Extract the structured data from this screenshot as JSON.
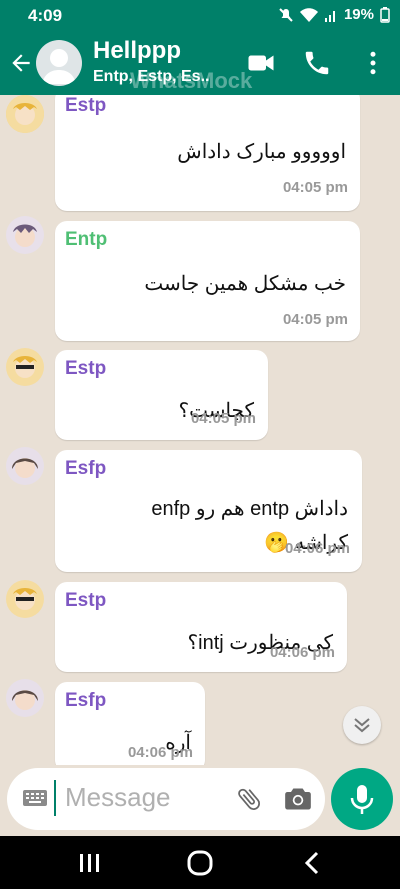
{
  "status_bar": {
    "time": "4:09",
    "battery": "19%"
  },
  "app_bar": {
    "title": "Hellppp",
    "subtitle": "Entp, Estp, Es..",
    "watermark": "WhatsMock"
  },
  "messages": [
    {
      "sender": "Estp",
      "sender_color": "#7e57c2",
      "text": "اووووو مبارک داداش",
      "time": "04:05 pm"
    },
    {
      "sender": "Entp",
      "sender_color": "#4fbf74",
      "text": "خب مشکل همین جاست",
      "time": "04:05 pm"
    },
    {
      "sender": "Estp",
      "sender_color": "#7e57c2",
      "text": "کجاست؟",
      "time": "04:05 pm"
    },
    {
      "sender": "Esfp",
      "sender_color": "#7e57c2",
      "text": "داداش entp هم رو enfp",
      "text2": "کراشه 🫢",
      "time": "04:06 pm"
    },
    {
      "sender": "Estp",
      "sender_color": "#7e57c2",
      "text": "کی منظورت intj؟",
      "time": "04:06 pm"
    },
    {
      "sender": "Esfp",
      "sender_color": "#7e57c2",
      "text": "آره",
      "time": "04:06 pm"
    }
  ],
  "composer": {
    "placeholder": "Message"
  },
  "icons": [
    "back-arrow-icon",
    "video-call-icon",
    "phone-icon",
    "more-vert-icon",
    "keyboard-icon",
    "attach-icon",
    "camera-icon",
    "mic-icon",
    "chevron-down-icon"
  ]
}
